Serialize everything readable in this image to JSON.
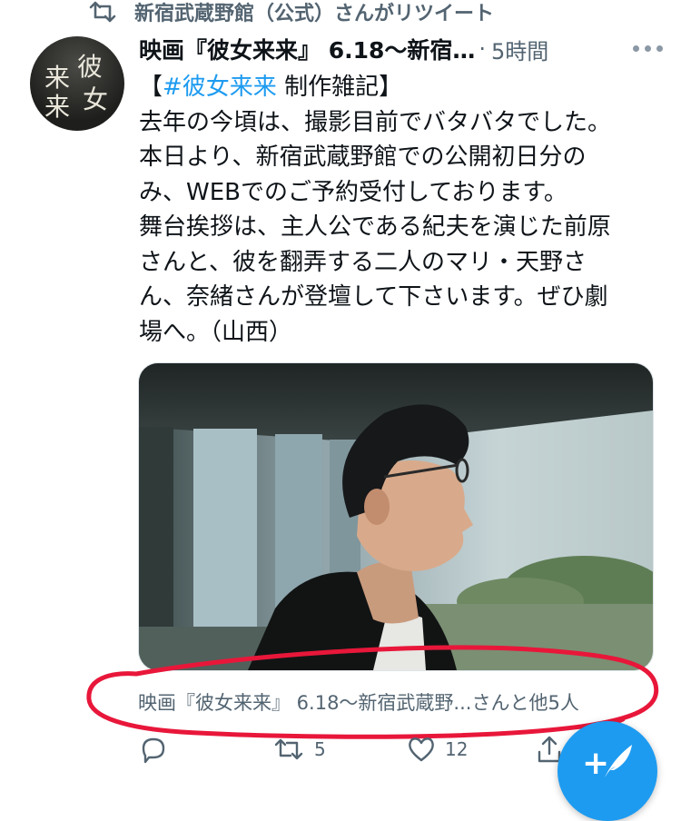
{
  "retweet_context": {
    "text": "新宿武蔵野館（公式）さんがリツイート",
    "icon": "retweet-icon"
  },
  "tweet": {
    "author_name": "映画『彼女来来』 6.18〜新宿…",
    "separator": "·",
    "timestamp": "5時間",
    "avatar_glyphs": [
      "彼",
      "女",
      "来",
      "来"
    ],
    "text": {
      "hashtag_open": "【",
      "hashtag": "#彼女来来",
      "hashtag_rest": " 制作雑記】",
      "lines": [
        "去年の今頃は、撮影目前でバタバタでした。",
        "本日より、新宿武蔵野館での公開初日分の",
        "み、WEBでのご予約受付しております。",
        "舞台挨拶は、主人公である紀夫を演じた前原",
        "さんと、彼を翻弄する二人のマリ・天野さ",
        "ん、奈緒さんが登壇して下さいます。ぜひ劇",
        "場へ。（山西）"
      ]
    },
    "media": {
      "description_icon": "photo-man-in-glasses"
    },
    "tagged_users": "映画『彼女来来』 6.18〜新宿武蔵野...さんと他5人",
    "actions": {
      "reply_count": "",
      "retweet_count": "5",
      "like_count": "12",
      "share_count": ""
    }
  },
  "compose_button": {
    "icon": "compose-feather-icon",
    "plus": "+"
  },
  "colors": {
    "accent": "#1d9bf0",
    "secondary_text": "#536471",
    "annotation_red": "#e8173a"
  }
}
